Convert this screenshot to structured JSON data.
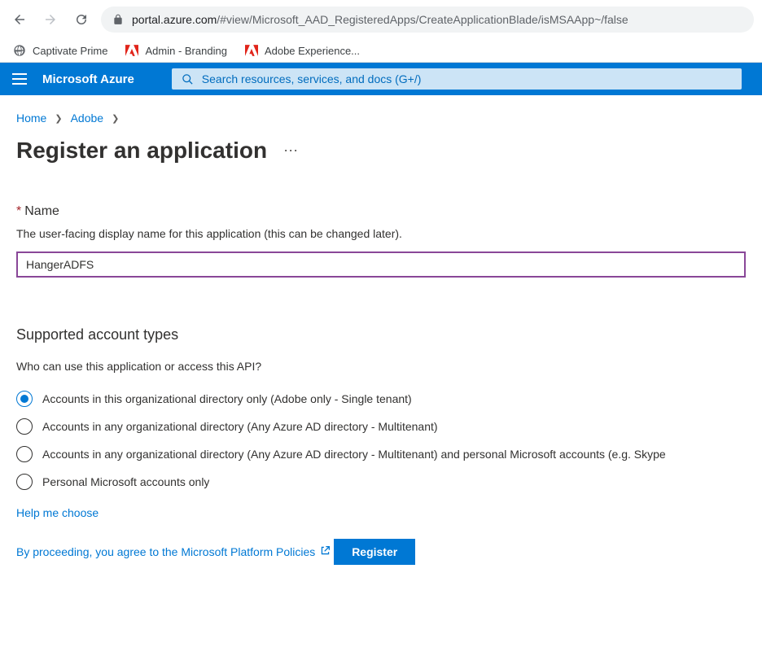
{
  "browser": {
    "url_host": "portal.azure.com",
    "url_path": "/#view/Microsoft_AAD_RegisteredApps/CreateApplicationBlade/isMSAApp~/false",
    "bookmarks": [
      "Captivate Prime",
      "Admin - Branding",
      "Adobe Experience..."
    ]
  },
  "header": {
    "brand": "Microsoft Azure",
    "search_placeholder": "Search resources, services, and docs (G+/)"
  },
  "breadcrumb": {
    "items": [
      "Home",
      "Adobe"
    ]
  },
  "page": {
    "title": "Register an application",
    "name_label": "Name",
    "name_help": "The user-facing display name for this application (this can be changed later).",
    "name_value": "HangerADFS",
    "account_types_heading": "Supported account types",
    "account_types_subheading": "Who can use this application or access this API?",
    "radio_options": [
      "Accounts in this organizational directory only (Adobe only - Single tenant)",
      "Accounts in any organizational directory (Any Azure AD directory - Multitenant)",
      "Accounts in any organizational directory (Any Azure AD directory - Multitenant) and personal Microsoft accounts (e.g. Skype",
      "Personal Microsoft accounts only"
    ],
    "radio_selected": 0,
    "help_choose": "Help me choose",
    "policies_text": "By proceeding, you agree to the Microsoft Platform Policies",
    "register_button": "Register"
  }
}
